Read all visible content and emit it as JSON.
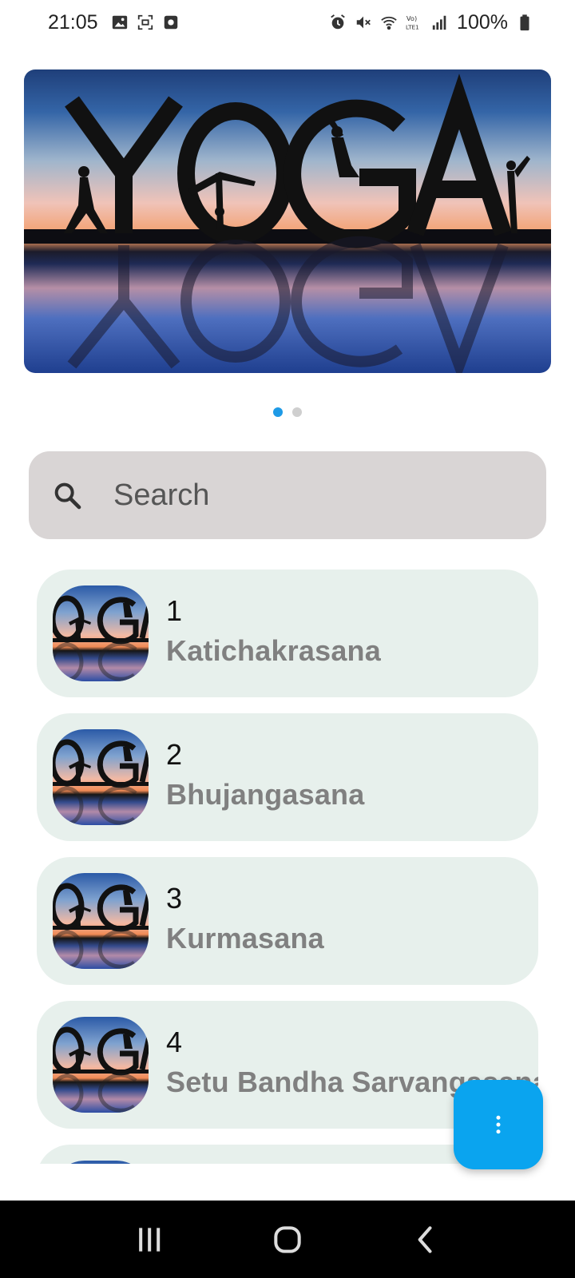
{
  "status_bar": {
    "time": "21:05",
    "battery": "100%",
    "left_icons": [
      "gallery-icon",
      "screenshot-icon",
      "app-notification-icon"
    ],
    "right_icons": [
      "alarm-icon",
      "mute-icon",
      "wifi-icon",
      "volte-icon",
      "signal-icon",
      "battery-icon"
    ]
  },
  "banner": {
    "word": "YOGA",
    "slides": 2,
    "active_slide": 0,
    "accent_color": "#1e9ae6"
  },
  "search": {
    "placeholder": "Search"
  },
  "asanas": [
    {
      "number": "1",
      "name": "Katichakrasana"
    },
    {
      "number": "2",
      "name": "Bhujangasana"
    },
    {
      "number": "3",
      "name": "Kurmasana"
    },
    {
      "number": "4",
      "name": "Setu Bandha Sarvangasana"
    }
  ],
  "fab": {
    "icon": "more-vertical-icon",
    "color": "#0aa4ef"
  },
  "nav_bar": {
    "buttons": [
      "recent-apps-icon",
      "home-icon",
      "back-icon"
    ]
  },
  "colors": {
    "card_bg": "#e7f0ec",
    "search_bg": "#d9d5d5"
  }
}
